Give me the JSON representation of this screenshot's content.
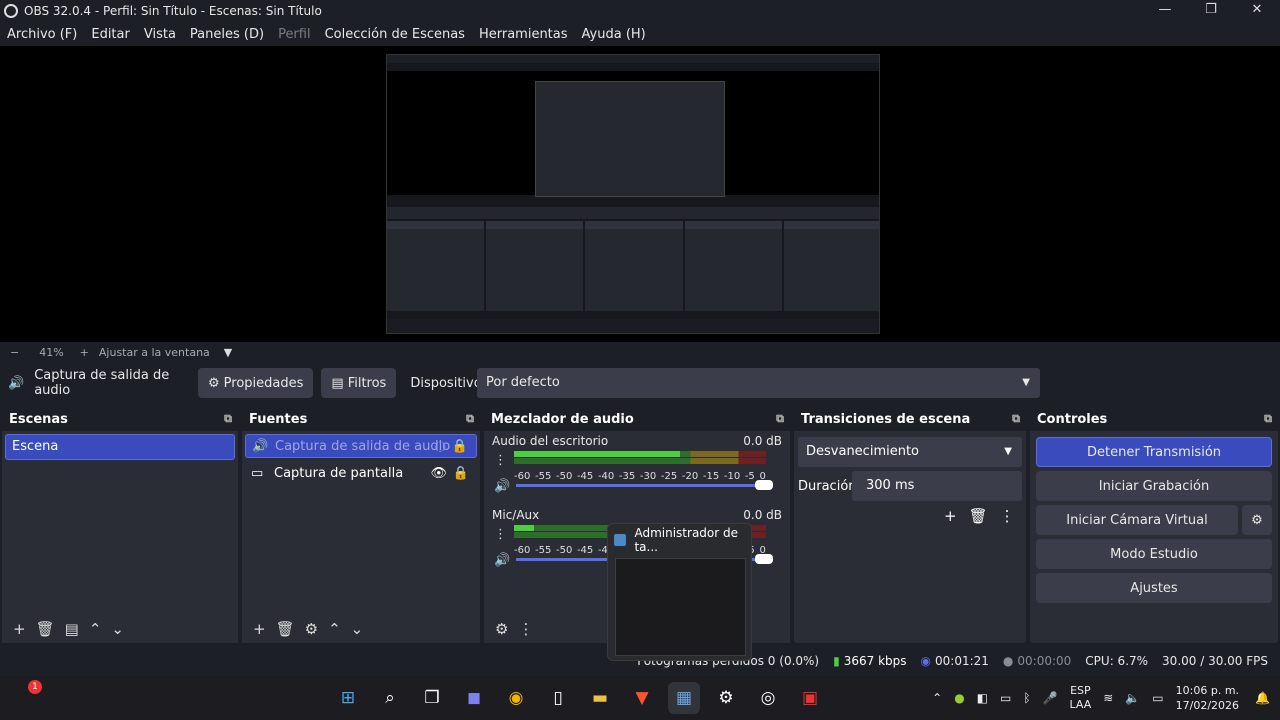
{
  "window": {
    "title": "OBS 32.0.4 - Perfil: Sin Título - Escenas: Sin Título",
    "minimize": "—",
    "maximize": "❐",
    "close": "✕"
  },
  "menu": [
    {
      "label": "Archivo (F)",
      "disabled": false
    },
    {
      "label": "Editar",
      "disabled": false
    },
    {
      "label": "Vista",
      "disabled": false
    },
    {
      "label": "Paneles (D)",
      "disabled": false
    },
    {
      "label": "Perfil",
      "disabled": true
    },
    {
      "label": "Colección de Escenas",
      "disabled": false
    },
    {
      "label": "Herramientas",
      "disabled": false
    },
    {
      "label": "Ayuda (H)",
      "disabled": false
    }
  ],
  "zoom": {
    "minus": "−",
    "value": "41%",
    "plus": "+",
    "fit_label": "Ajustar a la ventana",
    "arrow": "▼"
  },
  "source_toolbar": {
    "source_name": "Captura de salida de audio",
    "properties": "Propiedades",
    "filters": "Filtros",
    "device_label": "Dispositivo",
    "device_value": "Por defecto"
  },
  "scenes": {
    "title": "Escenas",
    "items": [
      "Escena"
    ]
  },
  "sources": {
    "title": "Fuentes",
    "items": [
      {
        "label": "Captura de salida de audio",
        "selected": true
      },
      {
        "label": "Captura de pantalla",
        "selected": false
      }
    ]
  },
  "mixer": {
    "title": "Mezclador de audio",
    "channels": [
      {
        "name": "Audio del escritorio",
        "level": "0.0 dB",
        "fill": 0.66
      },
      {
        "name": "Mic/Aux",
        "level": "0.0 dB",
        "fill": 0.08
      }
    ],
    "ticks": [
      "-60",
      "-55",
      "-50",
      "-45",
      "-40",
      "-35",
      "-30",
      "-25",
      "-20",
      "-15",
      "-10",
      "-5",
      "0"
    ]
  },
  "transitions": {
    "title": "Transiciones de escena",
    "selected": "Desvanecimiento",
    "duration_label": "Duración",
    "duration_value": "300 ms"
  },
  "controls": {
    "title": "Controles",
    "stop_stream": "Detener Transmisión",
    "start_recording": "Iniciar Grabación",
    "start_virtual_cam": "Iniciar Cámara Virtual",
    "studio_mode": "Modo Estudio",
    "settings": "Ajustes"
  },
  "status": {
    "dropped": "Fotogramas perdidos 0 (0.0%)",
    "bitrate": "3667 kbps",
    "stream_time": "00:01:21",
    "rec_time": "00:00:00",
    "cpu": "CPU: 6.7%",
    "fps": "30.00 / 30.00 FPS"
  },
  "popup": {
    "title": "Administrador de ta..."
  },
  "taskbar": {
    "notification_count": "1",
    "lang_top": "ESP",
    "lang_bottom": "LAA",
    "time": "10:06 p. m.",
    "date": "17/02/2026"
  },
  "colors": {
    "accent": "#3a4bbd",
    "meter_green": "#4bd13f",
    "background": "#1d1f26",
    "panel": "#2b2d36"
  }
}
